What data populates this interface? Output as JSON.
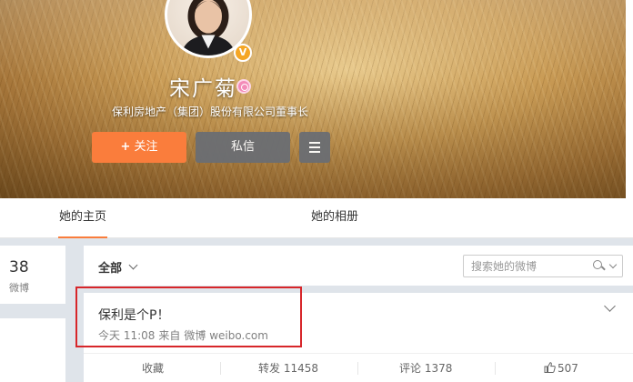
{
  "profile": {
    "name": "宋广菊",
    "title": "保利房地产（集团）股份有限公司董事长",
    "verified_badge": "V",
    "follow_plus": "+",
    "follow_label": "关注",
    "message_label": "私信"
  },
  "tabs": [
    {
      "label": "她的主页",
      "active": true
    },
    {
      "label": "她的相册",
      "active": false
    }
  ],
  "stats": {
    "count": "38",
    "label": "微博"
  },
  "feed_filter": {
    "selected": "全部",
    "search_placeholder": "搜索她的微博"
  },
  "post": {
    "text": "保利是个P！",
    "time": "今天 11:08",
    "source_prefix": "来自",
    "source": "微博 weibo.com"
  },
  "actions": {
    "favorite": "收藏",
    "repost": "转发 11458",
    "comment": "评论 1378",
    "like": "507"
  },
  "colors": {
    "follow_button": "#fa7d3c",
    "highlight": "#d7262a",
    "verified": "#f5a623"
  }
}
